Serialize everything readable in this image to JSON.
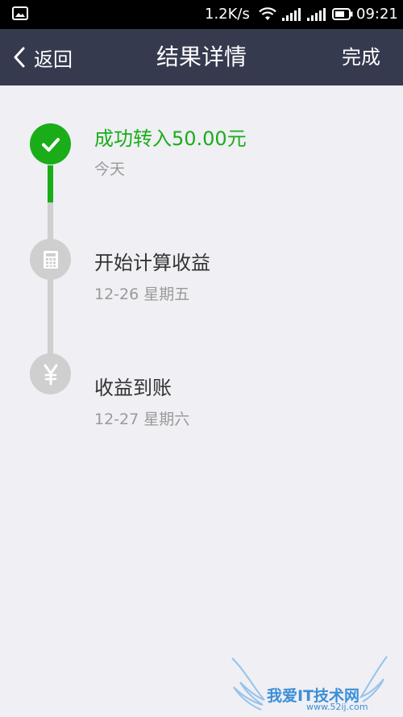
{
  "status_bar": {
    "speed": "1.2K/s",
    "time": "09:21",
    "icons": [
      "gallery-icon",
      "wifi-icon",
      "signal-icon",
      "signal-icon",
      "battery-icon"
    ]
  },
  "nav": {
    "back_label": "返回",
    "title": "结果详情",
    "done_label": "完成"
  },
  "steps": [
    {
      "title": "成功转入50.00元",
      "subtitle": "今天",
      "icon": "check-icon",
      "status": "done",
      "color": "#1aad19"
    },
    {
      "title": "开始计算收益",
      "subtitle": "12-26 星期五",
      "icon": "calculator-icon",
      "status": "pending",
      "color": "#cfcfcf"
    },
    {
      "title": "收益到账",
      "subtitle": "12-27 星期六",
      "icon": "yen-icon",
      "status": "pending",
      "color": "#cfcfcf"
    }
  ],
  "watermark": {
    "text": "我爱IT技术网",
    "url": "www.52ij.com"
  },
  "colors": {
    "accent": "#1aad19",
    "nav_bg": "#353a4e",
    "page_bg": "#efeff4"
  }
}
